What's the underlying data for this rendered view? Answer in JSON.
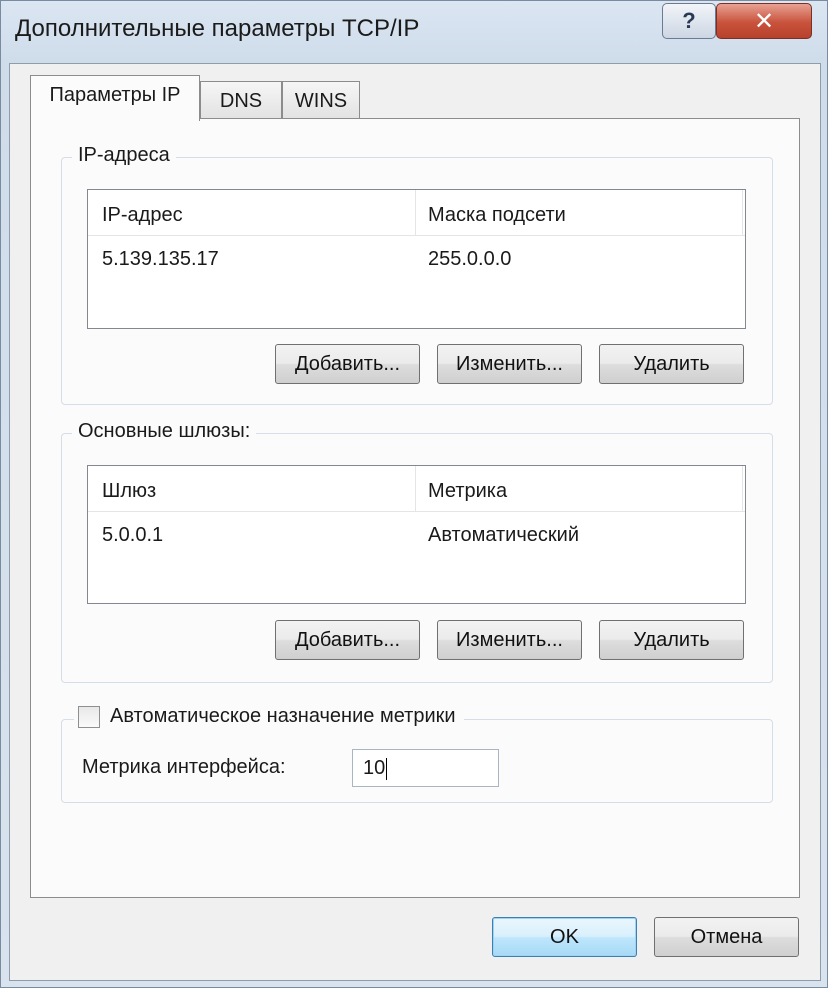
{
  "window": {
    "title": "Дополнительные параметры TCP/IP",
    "help_label": "?",
    "close_label": "✕"
  },
  "tabs": [
    {
      "label": "Параметры IP",
      "active": true
    },
    {
      "label": "DNS",
      "active": false
    },
    {
      "label": "WINS",
      "active": false
    }
  ],
  "ip_group": {
    "label": "IP-адреса",
    "columns": [
      "IP-адрес",
      "Маска подсети"
    ],
    "rows": [
      [
        "5.139.135.17",
        "255.0.0.0"
      ]
    ],
    "add_label": "Добавить...",
    "edit_label": "Изменить...",
    "delete_label": "Удалить"
  },
  "gateway_group": {
    "label": "Основные шлюзы:",
    "columns": [
      "Шлюз",
      "Метрика"
    ],
    "rows": [
      [
        "5.0.0.1",
        "Автоматический"
      ]
    ],
    "add_label": "Добавить...",
    "edit_label": "Изменить...",
    "delete_label": "Удалить"
  },
  "metric_group": {
    "auto_metric_label": "Автоматическое назначение метрики",
    "auto_metric_checked": false,
    "interface_metric_label": "Метрика интерфейса:",
    "interface_metric_value": "10"
  },
  "footer": {
    "ok_label": "OK",
    "cancel_label": "Отмена"
  },
  "colors": {
    "close_button": "#c8523c",
    "default_button_border": "#3c7fb1",
    "panel_background": "#fbfbfb"
  }
}
